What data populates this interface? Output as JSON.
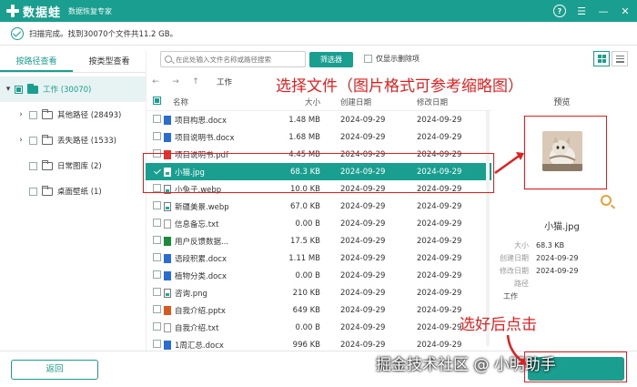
{
  "titlebar": {
    "app_name": "数据蛙",
    "subtitle": "数据恢复专家"
  },
  "status": {
    "text": "扫描完成。找到30070个文件共11.2 GB。"
  },
  "left_tabs": [
    "按路径查看",
    "按类型查看"
  ],
  "tree": [
    {
      "label": "工作 (30070)",
      "selected": true
    },
    {
      "label": "其他路径 (28493)",
      "expandable": true
    },
    {
      "label": "丢失路径 (1533)",
      "expandable": true
    },
    {
      "label": "日常图库 (2)"
    },
    {
      "label": "桌面壁纸 (1)"
    }
  ],
  "toolbar": {
    "search_placeholder": "在此处输入文件名称或路径搜索",
    "filter_label": "筛选器",
    "deleted_only_label": "仅显示删除项"
  },
  "nav": {
    "back": "←",
    "forward": "→",
    "up": "↑",
    "crumb": "工作"
  },
  "table": {
    "headers": [
      "名称",
      "大小",
      "创建日期",
      "修改日期"
    ],
    "rows": [
      {
        "name": "项目构思.docx",
        "size": "1.48 MB",
        "created": "2024-09-29",
        "modified": "2024-09-29",
        "type": "doc"
      },
      {
        "name": "项目说明书.docx",
        "size": "1.68 MB",
        "created": "2024-09-29",
        "modified": "2024-09-29",
        "type": "doc"
      },
      {
        "name": "项目说明书.pdf",
        "size": "4.45 MB",
        "created": "2024-09-29",
        "modified": "2024-09-29",
        "type": "pdf"
      },
      {
        "name": "小猫.jpg",
        "size": "68.3 KB",
        "created": "2024-09-29",
        "modified": "2024-09-29",
        "type": "img",
        "selected": true
      },
      {
        "name": "小兔子.webp",
        "size": "10.0 KB",
        "created": "2024-09-29",
        "modified": "2024-09-29",
        "type": "img"
      },
      {
        "name": "新疆美景.webp",
        "size": "67.0 KB",
        "created": "2024-09-29",
        "modified": "2024-09-29",
        "type": "img"
      },
      {
        "name": "信息备忘.txt",
        "size": "0.00  B",
        "created": "2024-09-29",
        "modified": "2024-09-29",
        "type": "txt"
      },
      {
        "name": "用户反馈数据...",
        "size": "17.5 KB",
        "created": "2024-09-29",
        "modified": "2024-09-29",
        "type": "xls"
      },
      {
        "name": "语段积累.docx",
        "size": "1.11 MB",
        "created": "2024-09-29",
        "modified": "2024-09-29",
        "type": "doc"
      },
      {
        "name": "植物分类.docx",
        "size": "0.00  B",
        "created": "2024-09-29",
        "modified": "2024-09-29",
        "type": "doc"
      },
      {
        "name": "咨询.png",
        "size": "210 KB",
        "created": "2024-09-29",
        "modified": "2024-09-29",
        "type": "img"
      },
      {
        "name": "自我介绍.pptx",
        "size": "649 KB",
        "created": "2024-09-29",
        "modified": "2024-09-29",
        "type": "ppt"
      },
      {
        "name": "自我介绍.txt",
        "size": "0.00  B",
        "created": "2024-09-29",
        "modified": "2024-09-29",
        "type": "txt"
      },
      {
        "name": "1周汇总.docx",
        "size": "996 KB",
        "created": "2024-09-29",
        "modified": "2024-09-29",
        "type": "doc"
      }
    ]
  },
  "preview": {
    "title": "预览",
    "file_name": "小猫.jpg",
    "meta": [
      {
        "key": "大小",
        "value": "68.3 KB"
      },
      {
        "key": "创建日期",
        "value": "2024-09-29"
      },
      {
        "key": "修改日期",
        "value": "2024-09-29"
      },
      {
        "key": "路径",
        "value": ""
      }
    ],
    "path_value": "工作"
  },
  "bottom": {
    "back_label": "返回"
  },
  "annotations": {
    "select_file": "选择文件（图片格式可参考缩略图）",
    "click_after": "选好后点击",
    "watermark": "掘金技术社区 @ 小明助手"
  },
  "colors": {
    "accent": "#1a9e8f",
    "annotation": "#e02020"
  }
}
